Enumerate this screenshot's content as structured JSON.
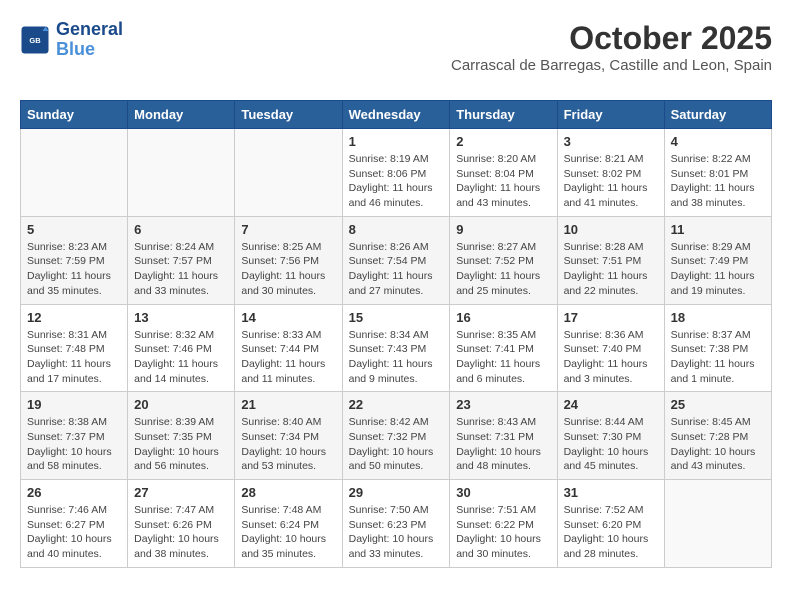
{
  "header": {
    "logo_line1": "General",
    "logo_line2": "Blue",
    "month_title": "October 2025",
    "location": "Carrascal de Barregas, Castille and Leon, Spain"
  },
  "weekdays": [
    "Sunday",
    "Monday",
    "Tuesday",
    "Wednesday",
    "Thursday",
    "Friday",
    "Saturday"
  ],
  "weeks": [
    [
      {
        "day": "",
        "info": ""
      },
      {
        "day": "",
        "info": ""
      },
      {
        "day": "",
        "info": ""
      },
      {
        "day": "1",
        "info": "Sunrise: 8:19 AM\nSunset: 8:06 PM\nDaylight: 11 hours\nand 46 minutes."
      },
      {
        "day": "2",
        "info": "Sunrise: 8:20 AM\nSunset: 8:04 PM\nDaylight: 11 hours\nand 43 minutes."
      },
      {
        "day": "3",
        "info": "Sunrise: 8:21 AM\nSunset: 8:02 PM\nDaylight: 11 hours\nand 41 minutes."
      },
      {
        "day": "4",
        "info": "Sunrise: 8:22 AM\nSunset: 8:01 PM\nDaylight: 11 hours\nand 38 minutes."
      }
    ],
    [
      {
        "day": "5",
        "info": "Sunrise: 8:23 AM\nSunset: 7:59 PM\nDaylight: 11 hours\nand 35 minutes."
      },
      {
        "day": "6",
        "info": "Sunrise: 8:24 AM\nSunset: 7:57 PM\nDaylight: 11 hours\nand 33 minutes."
      },
      {
        "day": "7",
        "info": "Sunrise: 8:25 AM\nSunset: 7:56 PM\nDaylight: 11 hours\nand 30 minutes."
      },
      {
        "day": "8",
        "info": "Sunrise: 8:26 AM\nSunset: 7:54 PM\nDaylight: 11 hours\nand 27 minutes."
      },
      {
        "day": "9",
        "info": "Sunrise: 8:27 AM\nSunset: 7:52 PM\nDaylight: 11 hours\nand 25 minutes."
      },
      {
        "day": "10",
        "info": "Sunrise: 8:28 AM\nSunset: 7:51 PM\nDaylight: 11 hours\nand 22 minutes."
      },
      {
        "day": "11",
        "info": "Sunrise: 8:29 AM\nSunset: 7:49 PM\nDaylight: 11 hours\nand 19 minutes."
      }
    ],
    [
      {
        "day": "12",
        "info": "Sunrise: 8:31 AM\nSunset: 7:48 PM\nDaylight: 11 hours\nand 17 minutes."
      },
      {
        "day": "13",
        "info": "Sunrise: 8:32 AM\nSunset: 7:46 PM\nDaylight: 11 hours\nand 14 minutes."
      },
      {
        "day": "14",
        "info": "Sunrise: 8:33 AM\nSunset: 7:44 PM\nDaylight: 11 hours\nand 11 minutes."
      },
      {
        "day": "15",
        "info": "Sunrise: 8:34 AM\nSunset: 7:43 PM\nDaylight: 11 hours\nand 9 minutes."
      },
      {
        "day": "16",
        "info": "Sunrise: 8:35 AM\nSunset: 7:41 PM\nDaylight: 11 hours\nand 6 minutes."
      },
      {
        "day": "17",
        "info": "Sunrise: 8:36 AM\nSunset: 7:40 PM\nDaylight: 11 hours\nand 3 minutes."
      },
      {
        "day": "18",
        "info": "Sunrise: 8:37 AM\nSunset: 7:38 PM\nDaylight: 11 hours\nand 1 minute."
      }
    ],
    [
      {
        "day": "19",
        "info": "Sunrise: 8:38 AM\nSunset: 7:37 PM\nDaylight: 10 hours\nand 58 minutes."
      },
      {
        "day": "20",
        "info": "Sunrise: 8:39 AM\nSunset: 7:35 PM\nDaylight: 10 hours\nand 56 minutes."
      },
      {
        "day": "21",
        "info": "Sunrise: 8:40 AM\nSunset: 7:34 PM\nDaylight: 10 hours\nand 53 minutes."
      },
      {
        "day": "22",
        "info": "Sunrise: 8:42 AM\nSunset: 7:32 PM\nDaylight: 10 hours\nand 50 minutes."
      },
      {
        "day": "23",
        "info": "Sunrise: 8:43 AM\nSunset: 7:31 PM\nDaylight: 10 hours\nand 48 minutes."
      },
      {
        "day": "24",
        "info": "Sunrise: 8:44 AM\nSunset: 7:30 PM\nDaylight: 10 hours\nand 45 minutes."
      },
      {
        "day": "25",
        "info": "Sunrise: 8:45 AM\nSunset: 7:28 PM\nDaylight: 10 hours\nand 43 minutes."
      }
    ],
    [
      {
        "day": "26",
        "info": "Sunrise: 7:46 AM\nSunset: 6:27 PM\nDaylight: 10 hours\nand 40 minutes."
      },
      {
        "day": "27",
        "info": "Sunrise: 7:47 AM\nSunset: 6:26 PM\nDaylight: 10 hours\nand 38 minutes."
      },
      {
        "day": "28",
        "info": "Sunrise: 7:48 AM\nSunset: 6:24 PM\nDaylight: 10 hours\nand 35 minutes."
      },
      {
        "day": "29",
        "info": "Sunrise: 7:50 AM\nSunset: 6:23 PM\nDaylight: 10 hours\nand 33 minutes."
      },
      {
        "day": "30",
        "info": "Sunrise: 7:51 AM\nSunset: 6:22 PM\nDaylight: 10 hours\nand 30 minutes."
      },
      {
        "day": "31",
        "info": "Sunrise: 7:52 AM\nSunset: 6:20 PM\nDaylight: 10 hours\nand 28 minutes."
      },
      {
        "day": "",
        "info": ""
      }
    ]
  ]
}
